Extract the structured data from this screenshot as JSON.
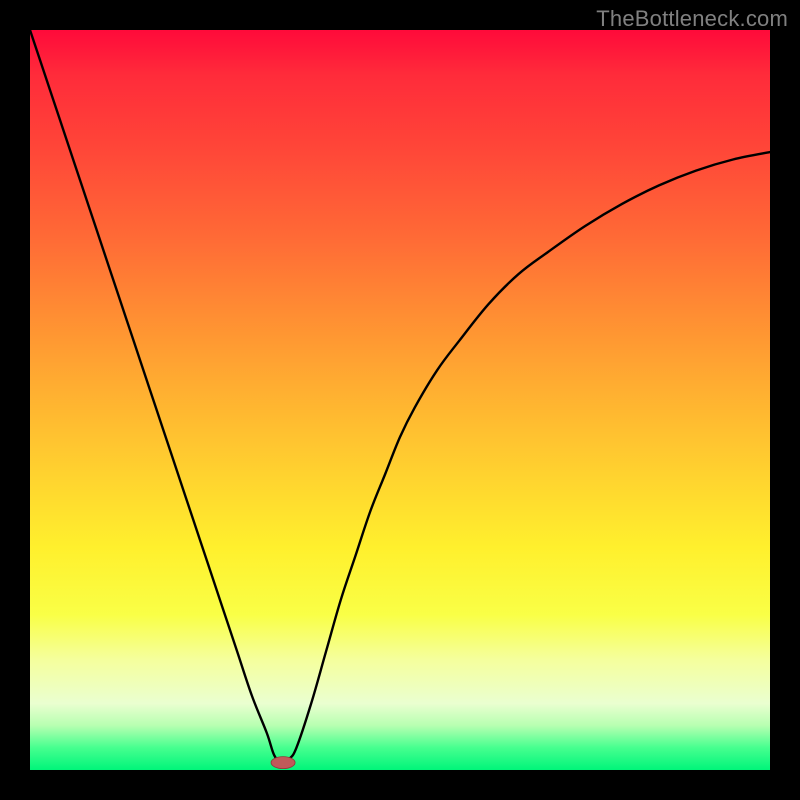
{
  "watermark": "TheBottleneck.com",
  "chart_data": {
    "type": "line",
    "title": "",
    "xlabel": "",
    "ylabel": "",
    "xlim": [
      0,
      100
    ],
    "ylim": [
      0,
      100
    ],
    "series": [
      {
        "name": "bottleneck-curve",
        "x": [
          0,
          2,
          4,
          6,
          8,
          10,
          12,
          14,
          16,
          18,
          20,
          22,
          24,
          26,
          28,
          30,
          32,
          33,
          34,
          35,
          36,
          38,
          40,
          42,
          44,
          46,
          48,
          50,
          52,
          55,
          58,
          62,
          66,
          70,
          75,
          80,
          85,
          90,
          95,
          100
        ],
        "values": [
          100,
          94,
          88,
          82,
          76,
          70,
          64,
          58,
          52,
          46,
          40,
          34,
          28,
          22,
          16,
          10,
          5,
          2,
          1,
          1.5,
          3,
          9,
          16,
          23,
          29,
          35,
          40,
          45,
          49,
          54,
          58,
          63,
          67,
          70,
          73.5,
          76.5,
          79,
          81,
          82.5,
          83.5
        ]
      }
    ],
    "annotations": [
      {
        "name": "optimal-point",
        "x": 34.2,
        "y": 1
      }
    ],
    "background_gradient": {
      "top_color": "#ff0a3a",
      "bottom_color": "#00f57a",
      "description": "red (top) through orange, yellow, to green (bottom)"
    },
    "grid": false,
    "legend": false
  }
}
